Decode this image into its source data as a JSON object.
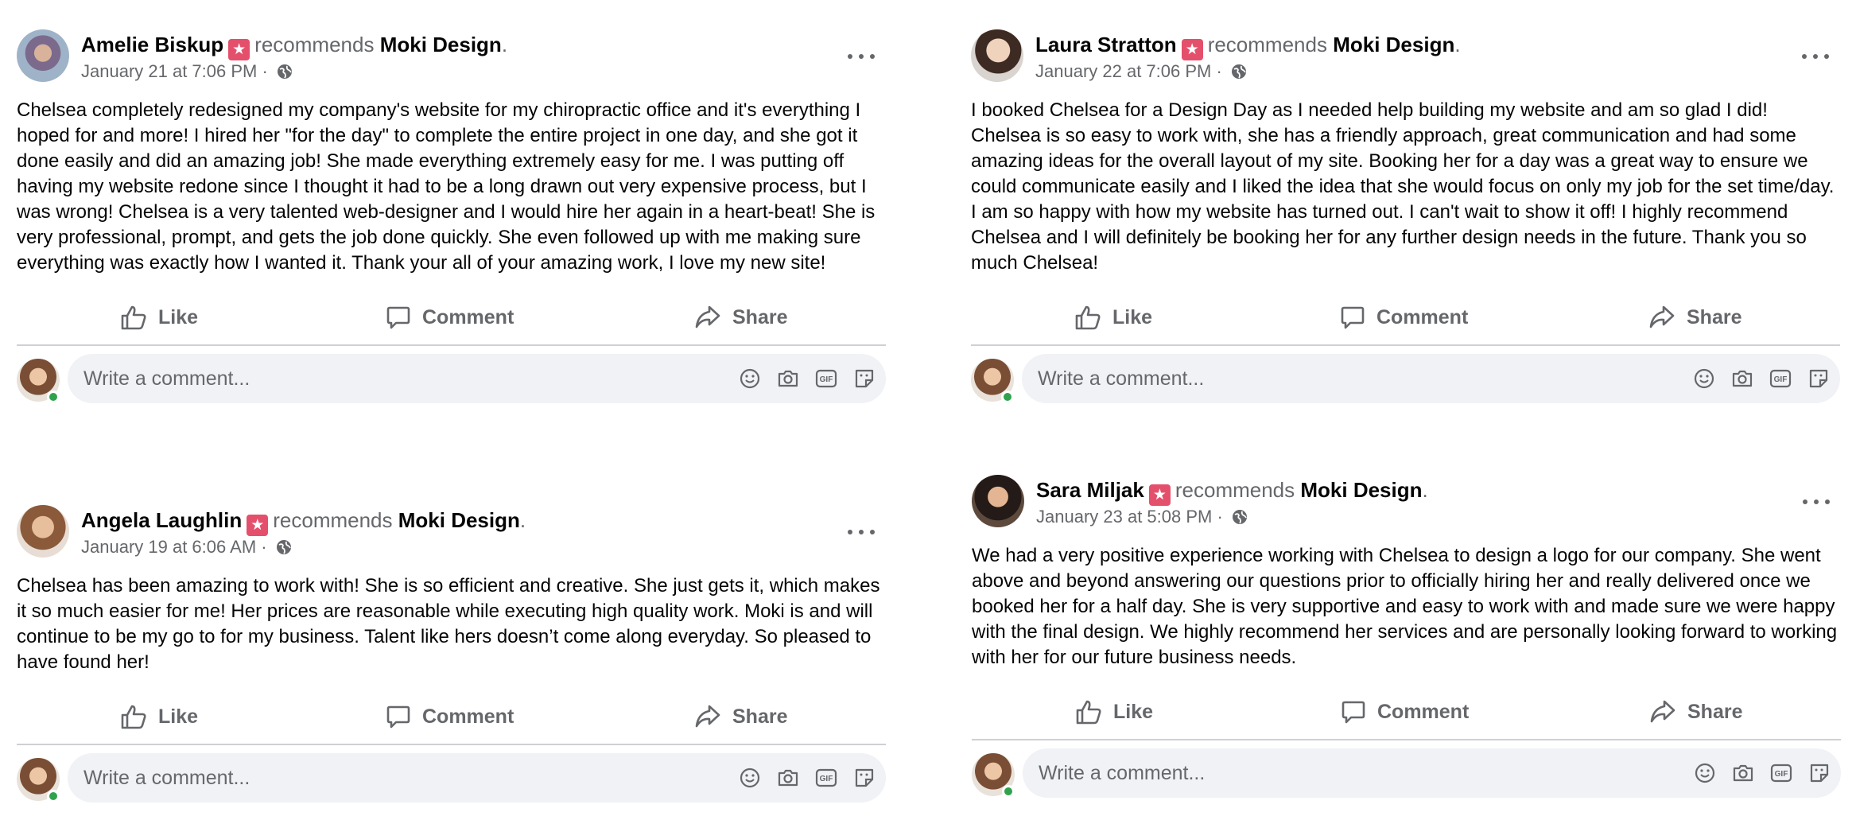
{
  "common": {
    "recommends": "recommends",
    "page_name": "Moki Design",
    "like": "Like",
    "comment": "Comment",
    "share": "Share",
    "comment_placeholder": "Write a comment...",
    "badge_icon": "recommendation-star-icon",
    "accent_color": "#e4506b"
  },
  "posts": [
    {
      "author": "Amelie Biskup",
      "date": "January 21 at 7:06 PM ·",
      "text": "Chelsea completely redesigned my company's website for my chiropractic office and it's everything I hoped for and more!  I hired her \"for the day\" to complete the entire project in one day, and she got it done easily and did an amazing job!  She made everything extremely easy for me.  I was putting off having my website redone since I thought it had to be a long drawn out very expensive process, but I was wrong!  Chelsea is a very talented web-designer and I would hire her again in a heart-beat!  She is very professional, prompt, and gets the job done quickly.  She even followed up with me making sure everything was exactly how I wanted it. Thank your all of your amazing work, I love my new site!"
    },
    {
      "author": "Laura Stratton",
      "date": "January 22 at 7:06 PM ·",
      "text": "I booked Chelsea for a Design Day as I needed help building my website and am so glad I did! Chelsea is so easy to work with, she has a friendly approach, great communication and had some amazing ideas for the overall layout of my site. Booking her for a day was a great way to ensure we could communicate easily and I liked the idea that she would focus on only my job for the set time/day. I am so happy with how my website has turned out. I can't wait to show it off! I highly recommend Chelsea and I will definitely be booking her for any further design needs in the future. Thank you so much Chelsea!"
    },
    {
      "author": "Angela Laughlin",
      "date": "January 19 at 6:06 AM ·",
      "text": "Chelsea has been amazing to work with! She is so efficient and creative. She just gets it, which makes it so much easier for me! Her prices are reasonable while executing high quality work. Moki is and will continue to be my go to for my business. Talent like hers doesn’t come along everyday. So pleased to have found her!"
    },
    {
      "author": "Sara Miljak",
      "date": "January 23 at 5:08 PM ·",
      "text": "We had a very positive experience working with Chelsea to design a logo for our company. She went above and beyond answering our questions prior to officially hiring her and really delivered once we booked her for a half day. She is very supportive and easy to work with and made sure we were happy with the final design. We highly recommend her services and are personally looking forward to working with her for our future business needs."
    }
  ]
}
